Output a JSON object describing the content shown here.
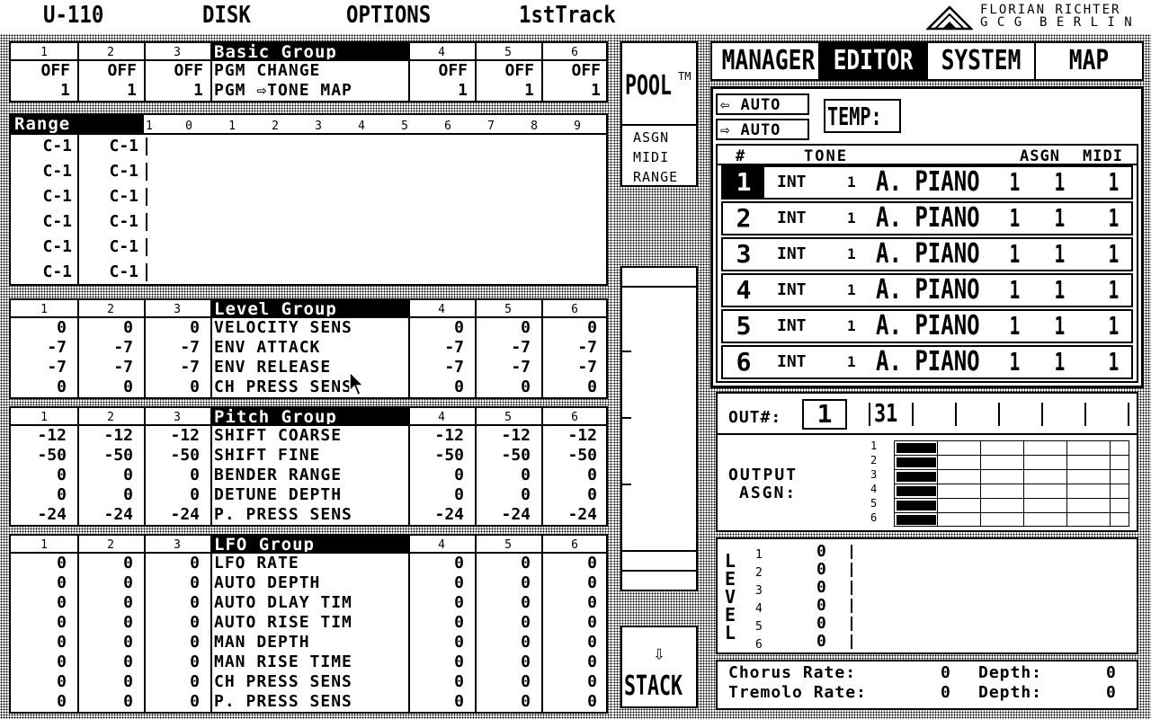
{
  "menu": {
    "items": [
      "U-110",
      "DISK",
      "OPTIONS",
      "1stTrack"
    ]
  },
  "credits": {
    "line1": "FLORIAN RICHTER",
    "line2": "G C G  B E R L I N"
  },
  "basic_group": {
    "title": "Basic Group",
    "cols": [
      "1",
      "2",
      "3",
      "4",
      "5",
      "6"
    ],
    "labels": [
      "PGM CHANGE",
      "PGM ⇨TONE MAP"
    ],
    "rows": [
      [
        "OFF",
        "OFF",
        "OFF",
        "OFF",
        "OFF",
        "OFF"
      ],
      [
        "1",
        "1",
        "1",
        "1",
        "1",
        "1"
      ]
    ]
  },
  "range": {
    "title": "Range",
    "scale": [
      "-1",
      "0",
      "1",
      "2",
      "3",
      "4",
      "5",
      "6",
      "7",
      "8",
      "9"
    ],
    "rows": [
      [
        "C-1",
        "C-1"
      ],
      [
        "C-1",
        "C-1"
      ],
      [
        "C-1",
        "C-1"
      ],
      [
        "C-1",
        "C-1"
      ],
      [
        "C-1",
        "C-1"
      ],
      [
        "C-1",
        "C-1"
      ]
    ]
  },
  "level_group": {
    "title": "Level Group",
    "cols": [
      "1",
      "2",
      "3",
      "4",
      "5",
      "6"
    ],
    "labels": [
      "VELOCITY SENS",
      "ENV ATTACK",
      "ENV RELEASE",
      "CH PRESS SENS"
    ],
    "rows": [
      [
        "0",
        "0",
        "0",
        "0",
        "0",
        "0"
      ],
      [
        "-7",
        "-7",
        "-7",
        "-7",
        "-7",
        "-7"
      ],
      [
        "-7",
        "-7",
        "-7",
        "-7",
        "-7",
        "-7"
      ],
      [
        "0",
        "0",
        "0",
        "0",
        "0",
        "0"
      ]
    ]
  },
  "pitch_group": {
    "title": "Pitch Group",
    "cols": [
      "1",
      "2",
      "3",
      "4",
      "5",
      "6"
    ],
    "labels": [
      "SHIFT COARSE",
      "SHIFT FINE",
      "BENDER RANGE",
      "DETUNE DEPTH",
      "P. PRESS SENS"
    ],
    "rows": [
      [
        "-12",
        "-12",
        "-12",
        "-12",
        "-12",
        "-12"
      ],
      [
        "-50",
        "-50",
        "-50",
        "-50",
        "-50",
        "-50"
      ],
      [
        "0",
        "0",
        "0",
        "0",
        "0",
        "0"
      ],
      [
        "0",
        "0",
        "0",
        "0",
        "0",
        "0"
      ],
      [
        "-24",
        "-24",
        "-24",
        "-24",
        "-24",
        "-24"
      ]
    ]
  },
  "lfo_group": {
    "title": "LFO Group",
    "cols": [
      "1",
      "2",
      "3",
      "4",
      "5",
      "6"
    ],
    "labels": [
      "LFO RATE",
      "AUTO DEPTH",
      "AUTO DLAY TIM",
      "AUTO RISE TIM",
      "MAN DEPTH",
      "MAN RISE TIME",
      "CH PRESS SENS",
      "P. PRESS SENS"
    ],
    "rows": [
      [
        "0",
        "0",
        "0",
        "0",
        "0",
        "0"
      ],
      [
        "0",
        "0",
        "0",
        "0",
        "0",
        "0"
      ],
      [
        "0",
        "0",
        "0",
        "0",
        "0",
        "0"
      ],
      [
        "0",
        "0",
        "0",
        "0",
        "0",
        "0"
      ],
      [
        "0",
        "0",
        "0",
        "0",
        "0",
        "0"
      ],
      [
        "0",
        "0",
        "0",
        "0",
        "0",
        "0"
      ],
      [
        "0",
        "0",
        "0",
        "0",
        "0",
        "0"
      ],
      [
        "0",
        "0",
        "0",
        "0",
        "0",
        "0"
      ]
    ]
  },
  "pool": {
    "label": "POOL",
    "tm": "TM",
    "options": [
      "ASGN",
      "MIDI",
      "RANGE"
    ]
  },
  "stack": {
    "arrow": "⇩",
    "label": "STACK"
  },
  "tabs": [
    {
      "label": "MANAGER",
      "active": false
    },
    {
      "label": "EDITOR",
      "active": true
    },
    {
      "label": "SYSTEM",
      "active": false
    },
    {
      "label": "MAP",
      "active": false
    }
  ],
  "editor": {
    "auto1": "⇦ AUTO",
    "auto2": "⇨ AUTO",
    "temp": "TEMP:",
    "table_headers": {
      "num": "#",
      "tone": "TONE",
      "asgn": "ASGN",
      "midi": "MIDI"
    },
    "tones": [
      {
        "num": "1",
        "src": "INT",
        "bank": "1",
        "name": "A. PIANO",
        "v1": "1",
        "asgn": "1",
        "midi": "1"
      },
      {
        "num": "2",
        "src": "INT",
        "bank": "1",
        "name": "A. PIANO",
        "v1": "1",
        "asgn": "1",
        "midi": "1"
      },
      {
        "num": "3",
        "src": "INT",
        "bank": "1",
        "name": "A. PIANO",
        "v1": "1",
        "asgn": "1",
        "midi": "1"
      },
      {
        "num": "4",
        "src": "INT",
        "bank": "1",
        "name": "A. PIANO",
        "v1": "1",
        "asgn": "1",
        "midi": "1"
      },
      {
        "num": "5",
        "src": "INT",
        "bank": "1",
        "name": "A. PIANO",
        "v1": "1",
        "asgn": "1",
        "midi": "1"
      },
      {
        "num": "6",
        "src": "INT",
        "bank": "1",
        "name": "A. PIANO",
        "v1": "1",
        "asgn": "1",
        "midi": "1"
      }
    ],
    "out_label": "OUT#:",
    "out_value": "1",
    "out_sel": "31",
    "output_asgn_label1": "OUTPUT",
    "output_asgn_label2": "ASGN:",
    "asgn_rows": [
      "1",
      "2",
      "3",
      "4",
      "5",
      "6"
    ],
    "level_letters": [
      "L",
      "E",
      "V",
      "E",
      "L"
    ],
    "level_rows": [
      [
        "1",
        "0"
      ],
      [
        "2",
        "0"
      ],
      [
        "3",
        "0"
      ],
      [
        "4",
        "0"
      ],
      [
        "5",
        "0"
      ],
      [
        "6",
        "0"
      ]
    ],
    "chorus_label": "Chorus Rate:",
    "chorus_rate": "0",
    "chorus_depth_label": "Depth:",
    "chorus_depth": "0",
    "tremolo_label": "Tremolo Rate:",
    "tremolo_rate": "0",
    "tremolo_depth_label": "Depth:",
    "tremolo_depth": "0"
  }
}
